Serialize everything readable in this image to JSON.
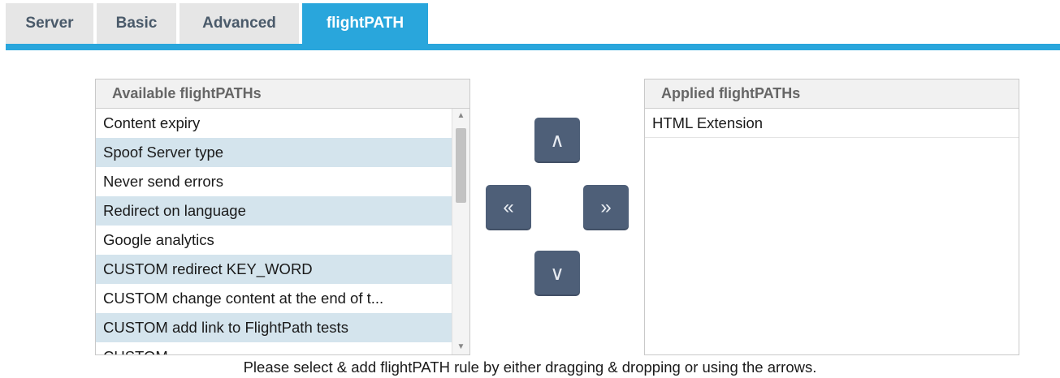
{
  "tabs": [
    {
      "label": "Server",
      "active": false
    },
    {
      "label": "Basic",
      "active": false
    },
    {
      "label": "Advanced",
      "active": false
    },
    {
      "label": "flightPATH",
      "active": true
    }
  ],
  "available": {
    "header": "Available flightPATHs",
    "items": [
      "Content expiry",
      "Spoof Server type",
      "Never send errors",
      "Redirect on language",
      "Google analytics",
      "CUSTOM redirect KEY_WORD",
      "CUSTOM change content at the end of t...",
      "CUSTOM add link to FlightPath tests",
      "CUSTOM ... ... ..."
    ]
  },
  "applied": {
    "header": "Applied flightPATHs",
    "items": [
      "HTML Extension"
    ]
  },
  "buttons": {
    "up": "∧",
    "left": "«",
    "right": "»",
    "down": "∨"
  },
  "footer": "Please select & add flightPATH rule by either dragging & dropping or using the arrows.",
  "colors": {
    "accent": "#29a6dc",
    "button": "#4e5f78",
    "row_alt": "#d4e4ed",
    "tab_inactive": "#e6e6e6"
  }
}
